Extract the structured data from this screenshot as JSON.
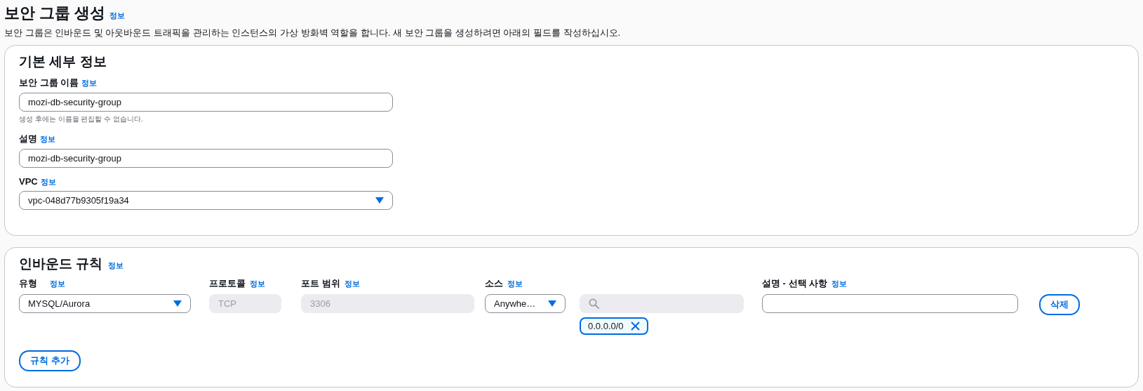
{
  "header": {
    "title": "보안 그룹 생성",
    "info_link": "정보",
    "description": "보안 그룹은 인바운드 및 아웃바운드 트래픽을 관리하는 인스턴스의 가상 방화벽 역할을 합니다. 새 보안 그룹을 생성하려면 아래의 필드를 작성하십시오."
  },
  "basic_details": {
    "title": "기본 세부 정보",
    "fields": [
      {
        "kind": "text",
        "label": "보안 그룹 이름",
        "info_link": "정보",
        "value": "mozi-db-security-group",
        "hint": "생성 후에는 이름을 편집할 수 없습니다."
      },
      {
        "kind": "text",
        "label": "설명",
        "info_link": "정보",
        "value": "mozi-db-security-group"
      },
      {
        "kind": "select",
        "label": "VPC",
        "info_link": "정보",
        "value": "vpc-048d77b9305f19a34"
      }
    ]
  },
  "inbound_rules": {
    "title": "인바운드 규칙",
    "info_link": "정보",
    "columns": [
      {
        "label": "유형",
        "info_link": "정보"
      },
      {
        "label": "프로토콜",
        "info_link": "정보"
      },
      {
        "label": "포트 범위",
        "info_link": "정보"
      },
      {
        "label": "소스",
        "info_link": "정보"
      },
      {
        "label": "설명 - 선택 사항",
        "info_link": "정보"
      }
    ],
    "rows": [
      {
        "type": "MYSQL/Aurora",
        "protocol": {
          "value": "TCP",
          "disabled": true
        },
        "port_range": {
          "value": "3306",
          "disabled": true
        },
        "source": "Anywhe…",
        "source_search": {
          "disabled": true
        },
        "source_tokens": [
          "0.0.0.0/0"
        ],
        "delete_button": "삭제"
      }
    ],
    "add_button": "규칙 추가"
  }
}
